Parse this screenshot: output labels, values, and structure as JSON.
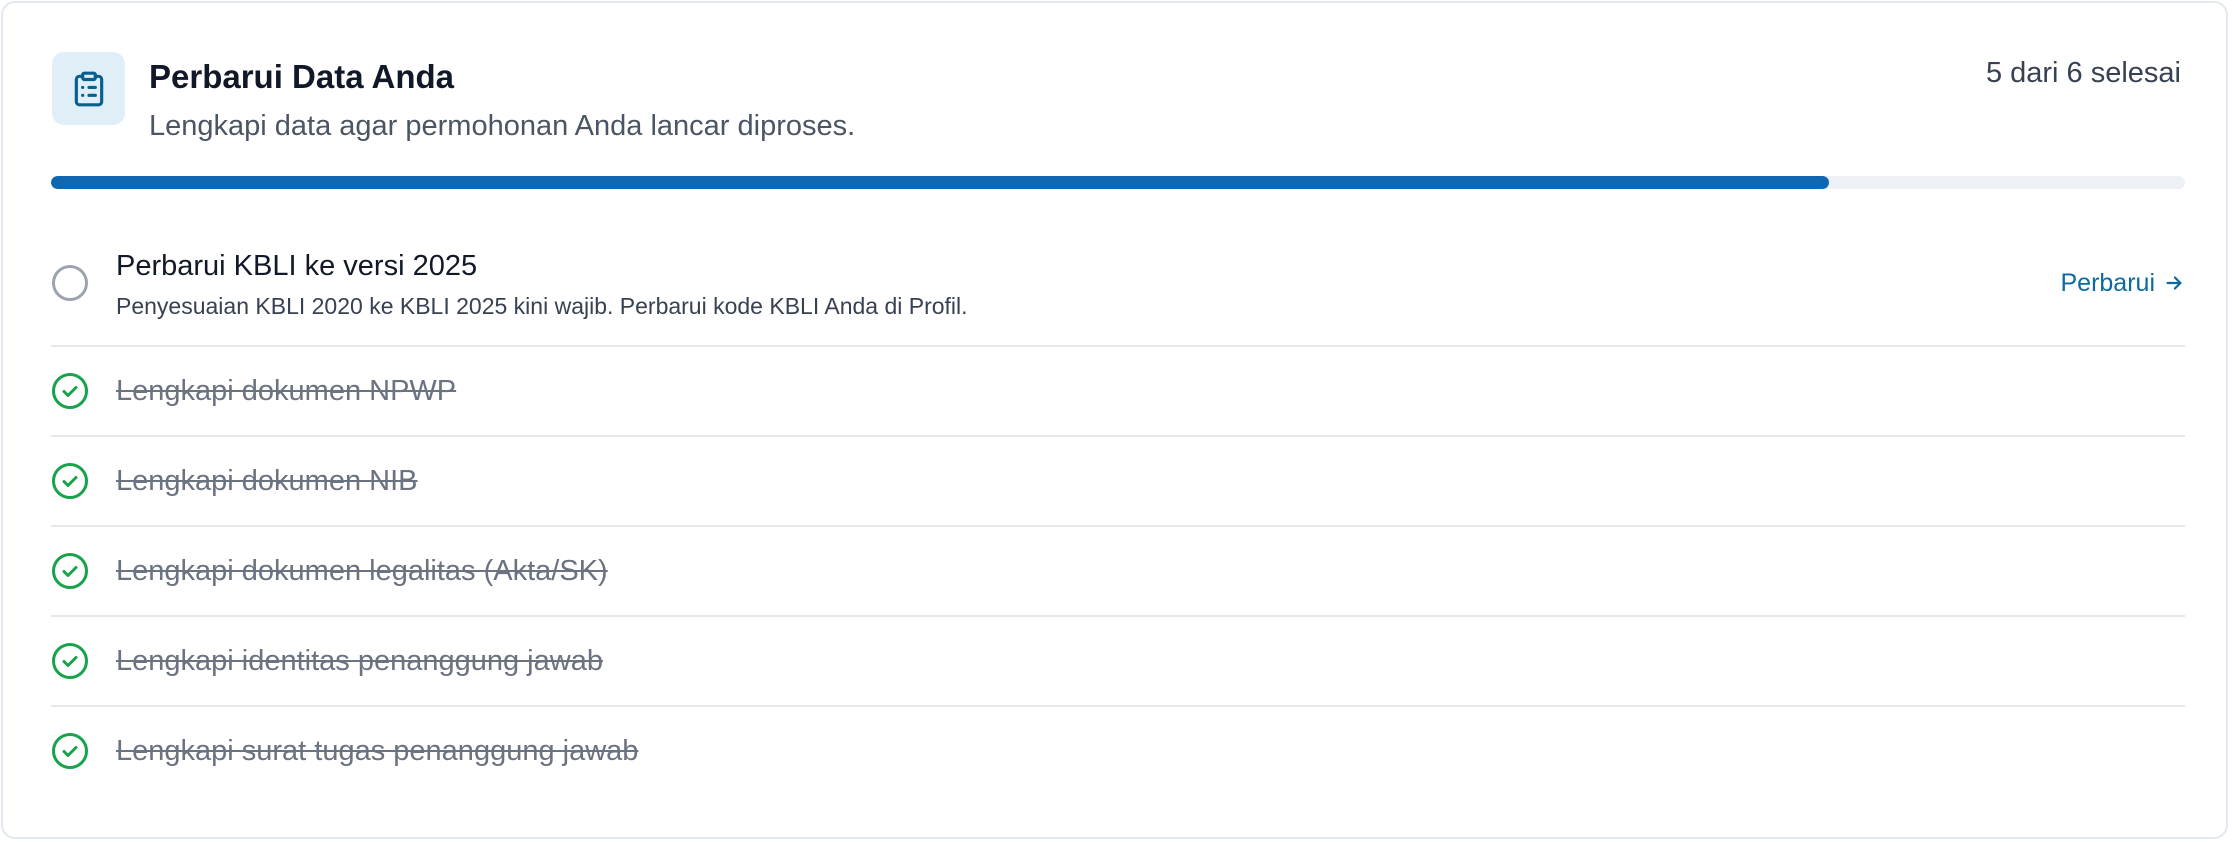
{
  "header": {
    "icon": "clipboard-list-icon",
    "title": "Perbarui Data Anda",
    "subtitle": "Lengkapi data agar permohonan Anda lancar diproses.",
    "progress_text": "5 dari 6 selesai",
    "progress": {
      "completed": 5,
      "total": 6
    }
  },
  "colors": {
    "accent": "#0f67b1",
    "success": "#16a34a",
    "link": "#0b6aa2",
    "pending_circle": "#9ca3af"
  },
  "tasks": [
    {
      "label": "Perbarui KBLI ke versi 2025",
      "description": "Penyesuaian KBLI 2020 ke KBLI 2025 kini wajib. Perbarui kode KBLI Anda di Profil.",
      "status": "pending",
      "icon": "empty-circle-icon",
      "action_label": "Perbarui",
      "action_icon": "arrow-right-icon"
    },
    {
      "label": "Lengkapi dokumen NPWP",
      "status": "done",
      "icon": "check-circle-icon"
    },
    {
      "label": "Lengkapi dokumen NIB",
      "status": "done",
      "icon": "check-circle-icon"
    },
    {
      "label": "Lengkapi dokumen legalitas (Akta/SK)",
      "status": "done",
      "icon": "check-circle-icon"
    },
    {
      "label": "Lengkapi identitas penanggung jawab",
      "status": "done",
      "icon": "check-circle-icon"
    },
    {
      "label": "Lengkapi surat tugas penanggung jawab",
      "status": "done",
      "icon": "check-circle-icon"
    }
  ]
}
